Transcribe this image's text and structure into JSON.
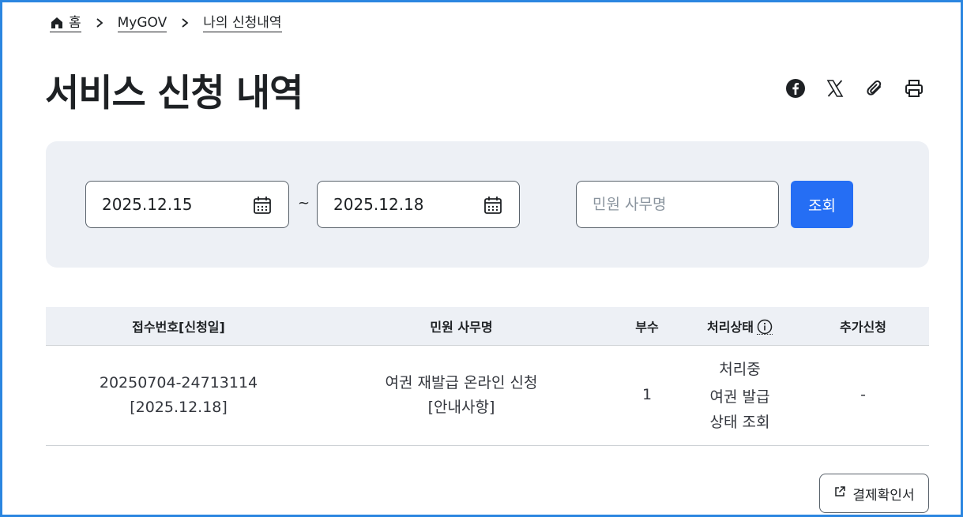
{
  "breadcrumb": {
    "home": "홈",
    "level1": "MyGOV",
    "level2": "나의 신청내역",
    "icons": [
      "home-icon",
      "chevron-right-icon"
    ]
  },
  "page": {
    "title": "서비스 신청 내역"
  },
  "share_icons": [
    "facebook-icon",
    "x-icon",
    "paperclip-icon",
    "print-icon"
  ],
  "filter": {
    "start_date": "2025.12.15",
    "end_date": "2025.12.18",
    "separator": "~",
    "search_placeholder": "민원 사무명",
    "search_value": "",
    "search_button": "조회"
  },
  "table": {
    "headers": [
      "접수번호[신청일]",
      "민원 사무명",
      "부수",
      "처리상태",
      "추가신청"
    ],
    "rows": [
      {
        "receipt_no": "20250704-24713114",
        "apply_date": "[2025.12.18]",
        "service_name": "여권 재발급 온라인 신청",
        "service_note": "[안내사항]",
        "copies": "1",
        "status": "처리중",
        "status_link_1": "여권 발급",
        "status_link_2": "상태 조회",
        "extra": "-"
      }
    ]
  },
  "receipt_button": "결제확인서",
  "colors": {
    "accent": "#256ef4",
    "panel_bg": "#edf0f5",
    "frame": "#2b86e0"
  }
}
